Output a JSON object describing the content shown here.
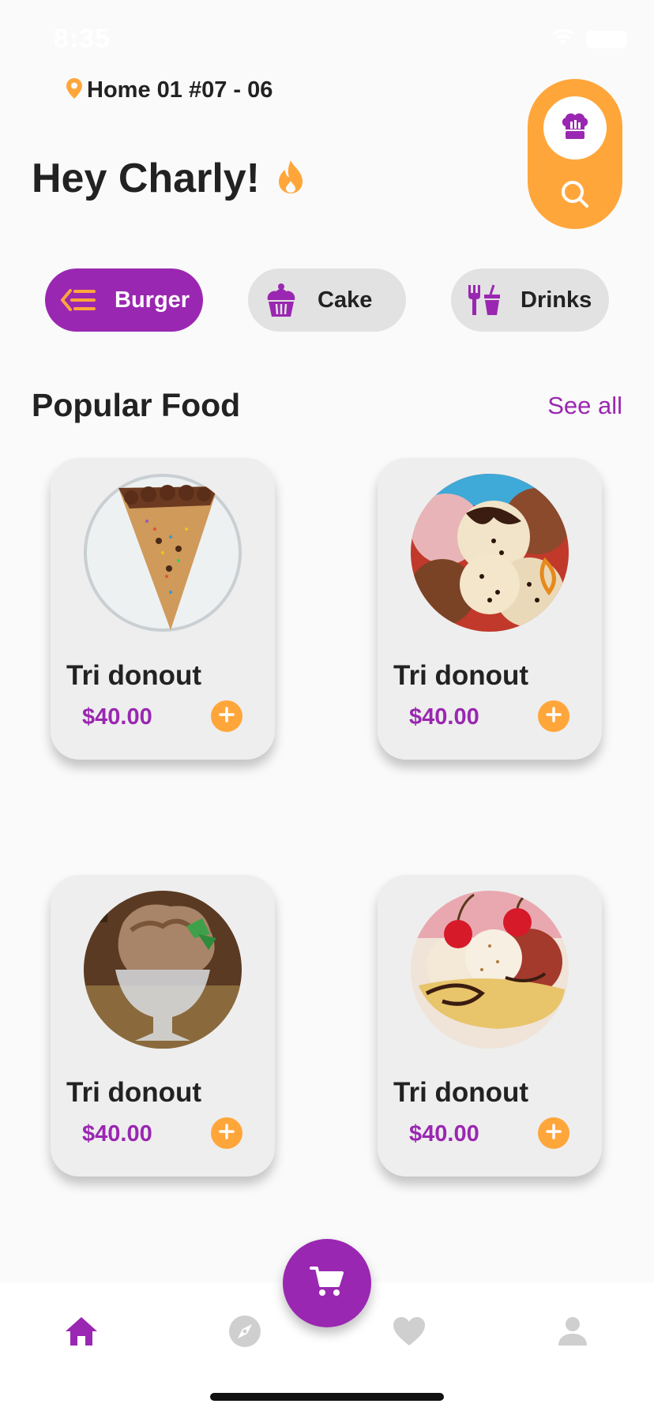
{
  "status_bar": {
    "time": "8:35"
  },
  "header": {
    "location": "Home 01 #07 - 06",
    "greeting": "Hey Charly!"
  },
  "categories": [
    {
      "label": "Burger",
      "icon": "burger-icon",
      "active": true
    },
    {
      "label": "Cake",
      "icon": "cupcake-icon",
      "active": false
    },
    {
      "label": "Drinks",
      "icon": "drinks-icon",
      "active": false
    }
  ],
  "section": {
    "title": "Popular Food",
    "see_all": "See all"
  },
  "foods": [
    {
      "name": "Tri donout",
      "price": "$40.00",
      "image": "cookie-pizza-image"
    },
    {
      "name": "Tri donout",
      "price": "$40.00",
      "image": "ice-cream-scoops-image"
    },
    {
      "name": "Tri donout",
      "price": "$40.00",
      "image": "chocolate-sundae-image"
    },
    {
      "name": "Tri donout",
      "price": "$40.00",
      "image": "banana-split-image"
    }
  ],
  "bottom_nav": [
    {
      "icon": "home-icon",
      "active": true
    },
    {
      "icon": "compass-icon",
      "active": false
    },
    {
      "icon": "heart-icon",
      "active": false
    },
    {
      "icon": "profile-icon",
      "active": false
    }
  ],
  "colors": {
    "primary": "#9a27b1",
    "accent": "#ffa63b",
    "background": "#fafafa",
    "card": "#eeeeee"
  }
}
